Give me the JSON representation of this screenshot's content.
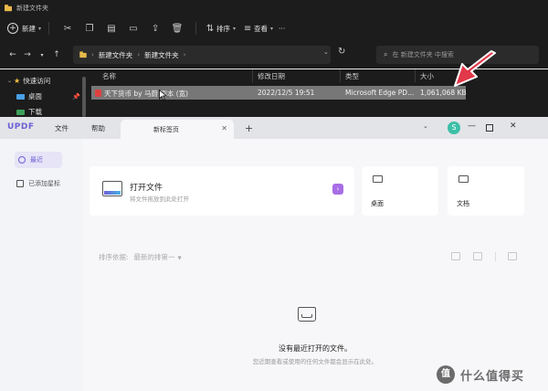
{
  "explorer": {
    "window_title": "新建文件夹",
    "toolbar": {
      "new_label": "新建",
      "sort_label": "排序",
      "view_label": "查看",
      "more_label": "···"
    },
    "address": {
      "crumbs": [
        "新建文件夹",
        "新建文件夹"
      ],
      "search_placeholder": "在 新建文件夹 中搜索"
    },
    "sidebar": {
      "quick_access": "快速访问",
      "desktop": "桌面",
      "downloads": "下载"
    },
    "columns": {
      "name": "名称",
      "modified": "修改日期",
      "type": "类型",
      "size": "大小"
    },
    "files": [
      {
        "name": "天下货币 by 马蔚 剧本 (宽)",
        "modified": "2022/12/5 19:51",
        "type": "Microsoft Edge PD...",
        "size": "1,061,068 KB"
      }
    ]
  },
  "updf": {
    "logo": "UPDF",
    "menu": {
      "file": "文件",
      "help": "帮助"
    },
    "tab_title": "新标签页",
    "avatar_letter": "S",
    "left_nav": [
      {
        "label": "最近",
        "active": true
      },
      {
        "label": "已添加星标",
        "active": false
      }
    ],
    "open_card": {
      "title": "打开文件",
      "subtitle": "将文件拖放到此处打开"
    },
    "quick_cards": [
      {
        "label": "桌面",
        "icon": "monitor-icon"
      },
      {
        "label": "文档",
        "icon": "folder-icon"
      }
    ],
    "sort": {
      "label": "排序依据:",
      "value": "最新的排第一"
    },
    "empty": {
      "title": "没有最近打开的文件。",
      "subtitle": "您近期查看或使用的任何文件都会显示在此处。"
    },
    "colors": {
      "accent": "#6b5fd6",
      "avatar": "#3cbfa8",
      "arrow_button": "#a86ee6"
    }
  },
  "watermark": {
    "logo_glyph": "值",
    "text": "什么值得买"
  }
}
